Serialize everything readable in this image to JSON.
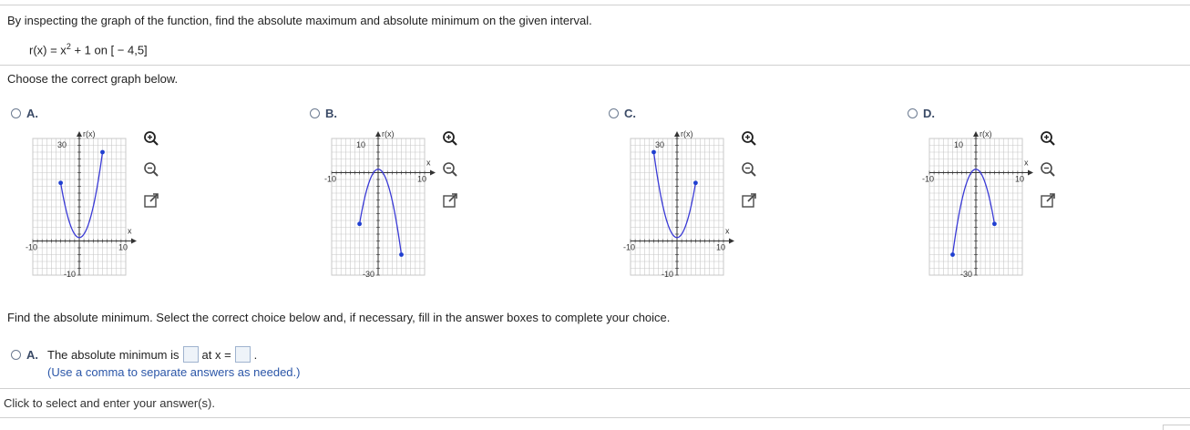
{
  "question": {
    "instruction": "By inspecting the graph of the function, find the absolute maximum and absolute minimum on the given interval.",
    "function_lhs": "r(x) = x",
    "exponent": "2",
    "function_rhs": " + 1 on [ − 4,5]",
    "choose_prompt": "Choose the correct graph below."
  },
  "graph_options": [
    {
      "letter": "A.",
      "ylabel": "r(x)",
      "xlabel": "x",
      "x_min_label": "-10",
      "x_max_label": "10",
      "y_top_label": "30",
      "y_bottom_label": "-10"
    },
    {
      "letter": "B.",
      "ylabel": "r(x)",
      "xlabel": "x",
      "x_min_label": "-10",
      "x_max_label": "10",
      "y_top_label": "10",
      "y_bottom_label": "-30"
    },
    {
      "letter": "C.",
      "ylabel": "r(x)",
      "xlabel": "x",
      "x_min_label": "-10",
      "x_max_label": "10",
      "y_top_label": "30",
      "y_bottom_label": "-10"
    },
    {
      "letter": "D.",
      "ylabel": "r(x)",
      "xlabel": "x",
      "x_min_label": "-10",
      "x_max_label": "10",
      "y_top_label": "10",
      "y_bottom_label": "-30"
    }
  ],
  "chart_data": [
    {
      "type": "line",
      "xlim": [
        -10,
        10
      ],
      "ylim": [
        -10,
        30
      ],
      "curve": "x^2+1",
      "domain": [
        -4,
        5
      ],
      "endpoints": [
        [
          -4,
          17
        ],
        [
          5,
          26
        ]
      ],
      "grid": true
    },
    {
      "type": "line",
      "xlim": [
        -10,
        10
      ],
      "ylim": [
        -30,
        10
      ],
      "curve": "-x^2+1",
      "domain": [
        -4,
        5
      ],
      "endpoints": [
        [
          -4,
          -15
        ],
        [
          5,
          -24
        ]
      ],
      "grid": true
    },
    {
      "type": "line",
      "xlim": [
        -10,
        10
      ],
      "ylim": [
        -10,
        30
      ],
      "curve": "x^2+1",
      "domain": [
        -5,
        4
      ],
      "endpoints": [
        [
          -5,
          26
        ],
        [
          4,
          17
        ]
      ],
      "grid": true
    },
    {
      "type": "line",
      "xlim": [
        -10,
        10
      ],
      "ylim": [
        -30,
        10
      ],
      "curve": "-x^2+1",
      "domain": [
        -5,
        4
      ],
      "endpoints": [
        [
          -5,
          -24
        ],
        [
          4,
          -15
        ]
      ],
      "grid": true
    }
  ],
  "tools": [
    {
      "name": "zoom-in-icon"
    },
    {
      "name": "zoom-out-icon"
    },
    {
      "name": "open-new-window-icon"
    }
  ],
  "answer": {
    "prompt": "Find the absolute minimum. Select the correct choice below and, if necessary, fill in the answer boxes to complete your choice.",
    "option_letter": "A.",
    "text_before": "The absolute minimum is",
    "text_middle": "at x =",
    "text_after": ".",
    "hint": "(Use a comma to separate answers as needed.)"
  },
  "status_text": "Click to select and enter your answer(s).",
  "colors": {
    "curve": "#3a3ad6",
    "point": "#1f3fd0",
    "grid": "#c8c8c8",
    "axis": "#333333"
  }
}
